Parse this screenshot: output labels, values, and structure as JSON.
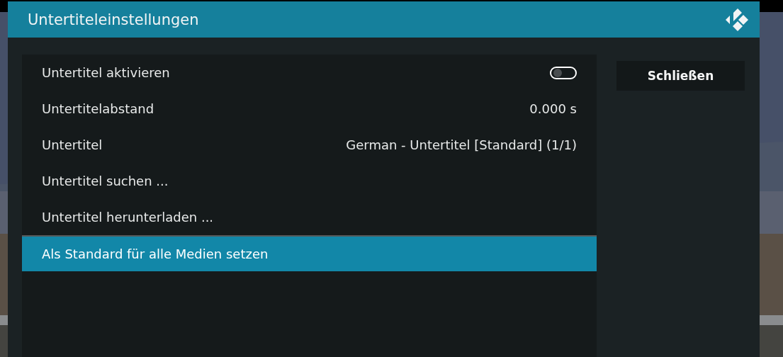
{
  "dialog": {
    "title": "Untertiteleinstellungen"
  },
  "settings": [
    {
      "label": "Untertitel aktivieren",
      "kind": "toggle",
      "on": false,
      "selected": false
    },
    {
      "label": "Untertitelabstand",
      "kind": "value",
      "value": "0.000 s",
      "selected": false
    },
    {
      "label": "Untertitel",
      "kind": "value",
      "value": "German - Untertitel [Standard] (1/1)",
      "selected": false
    },
    {
      "label": "Untertitel suchen ...",
      "kind": "action",
      "selected": false
    },
    {
      "label": "Untertitel herunterladen ...",
      "kind": "action",
      "selected": false
    },
    {
      "label": "Als Standard für alle Medien setzen",
      "kind": "action",
      "selected": true
    }
  ],
  "buttons": [
    "Schließen"
  ]
}
